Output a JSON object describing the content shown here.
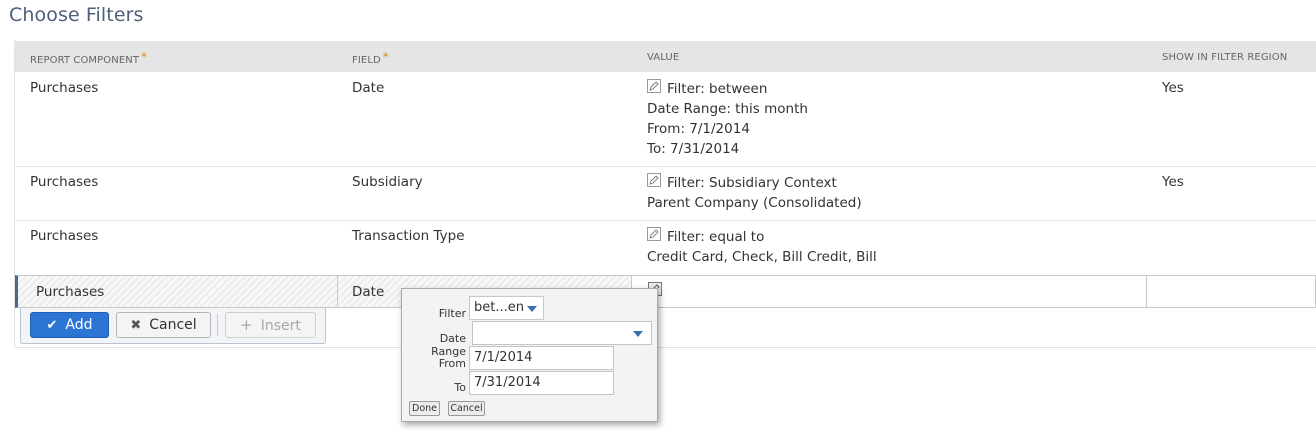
{
  "page": {
    "title": "Choose Filters"
  },
  "table": {
    "headers": {
      "component": "REPORT COMPONENT",
      "field": "FIELD",
      "value": "VALUE",
      "show": "SHOW IN FILTER REGION",
      "required_mark": "*"
    },
    "rows": [
      {
        "component": "Purchases",
        "field": "Date",
        "value": [
          "Filter: between",
          "Date Range: this month",
          "From: 7/1/2014",
          "To: 7/31/2014"
        ],
        "show": "Yes"
      },
      {
        "component": "Purchases",
        "field": "Subsidiary",
        "value": [
          "Filter: Subsidiary Context",
          "Parent Company (Consolidated)"
        ],
        "show": "Yes"
      },
      {
        "component": "Purchases",
        "field": "Transaction Type",
        "value": [
          "Filter: equal to",
          "Credit Card, Check, Bill Credit, Bill"
        ],
        "show": ""
      }
    ],
    "edit_row": {
      "component": "Purchases",
      "field": "Date"
    }
  },
  "actions": {
    "add": "Add",
    "cancel": "Cancel",
    "insert": "Insert"
  },
  "popup": {
    "filter_label": "Filter",
    "filter_value": "bet...en",
    "date_range_label": "Date Range",
    "date_range_value": "",
    "from_label": "From",
    "from_value": "7/1/2014",
    "to_label": "To",
    "to_value": "7/31/2014",
    "done": "Done",
    "cancel": "Cancel"
  },
  "colors": {
    "accent": "#2d75d5",
    "title": "#4d5f79",
    "required": "#e08a16"
  }
}
